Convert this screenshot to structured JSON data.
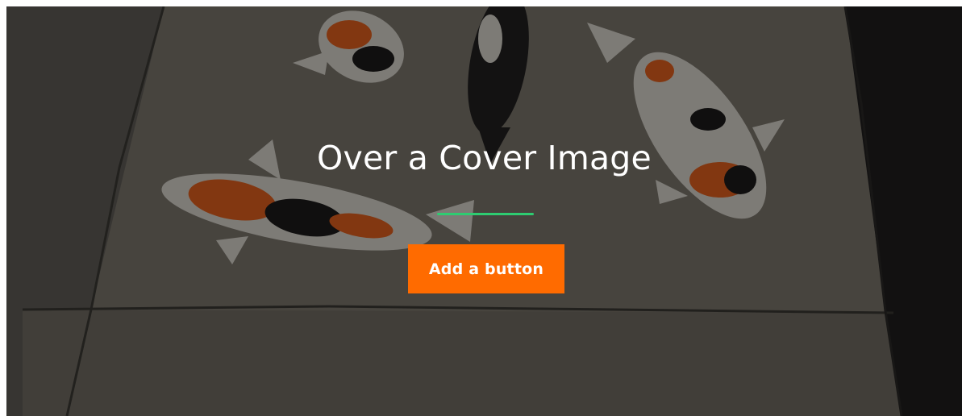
{
  "cover": {
    "title": "Over a Cover Image",
    "button_label": "Add a button",
    "background": "koi-fish-sidewalk-painting",
    "colors": {
      "separator": "#2ecc71",
      "button": "#ff6b00",
      "text": "#ffffff"
    }
  }
}
